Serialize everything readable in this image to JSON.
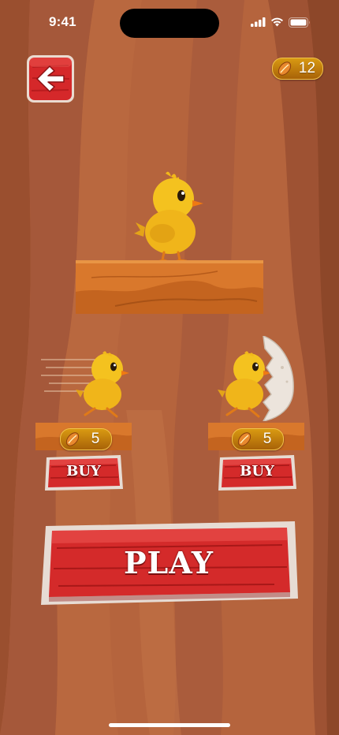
{
  "status_bar": {
    "time": "9:41"
  },
  "header": {
    "coin_count": "12"
  },
  "shop": {
    "items": [
      {
        "price": "5",
        "buy_label": "BUY"
      },
      {
        "price": "5",
        "buy_label": "BUY"
      }
    ]
  },
  "play_button": {
    "label": "PLAY"
  },
  "colors": {
    "background": "#b5623c",
    "button_red": "#d92b2b",
    "coin_gold": "#d99a12",
    "platform": "#d9782c"
  },
  "icons": [
    "back-arrow-icon",
    "seed-icon",
    "signal-icon",
    "wifi-icon",
    "battery-icon"
  ]
}
